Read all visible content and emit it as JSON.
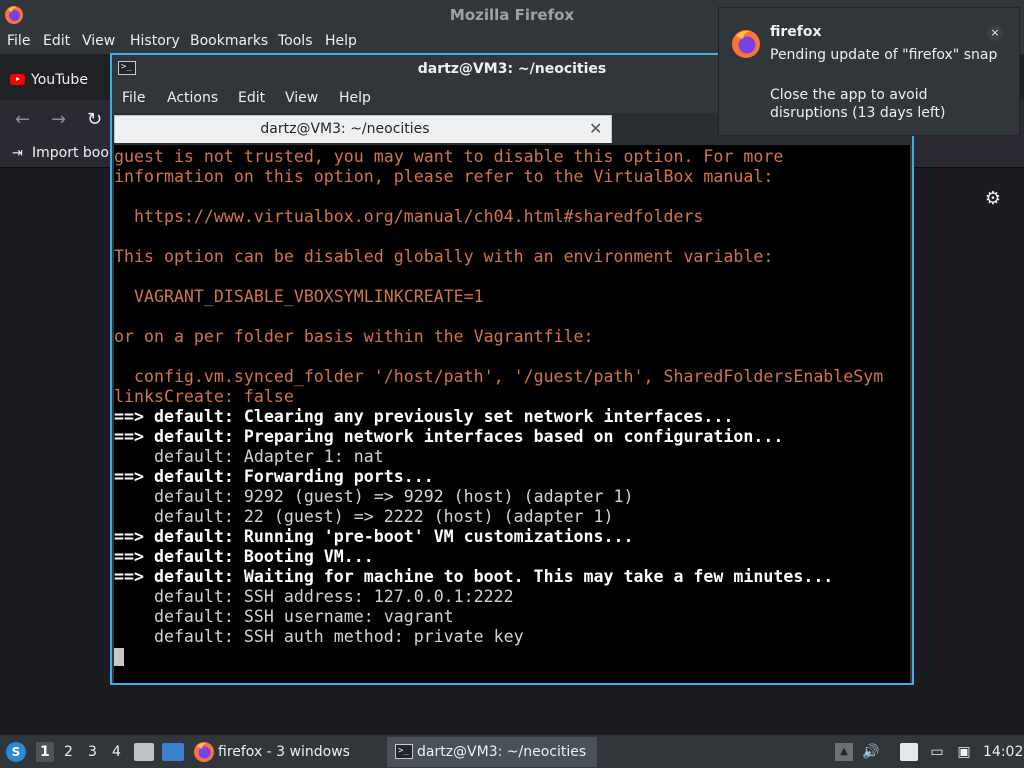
{
  "firefox": {
    "window_title": "Mozilla Firefox",
    "menu": [
      "File",
      "Edit",
      "View",
      "History",
      "Bookmarks",
      "Tools",
      "Help"
    ],
    "tab": {
      "label": "YouTube",
      "icon": "youtube-icon"
    },
    "bookmarks_toolbar": {
      "import_label": "Import book"
    },
    "settings_icon": "gear-icon"
  },
  "terminal": {
    "window_title": "dartz@VM3: ~/neocities",
    "menu": [
      "File",
      "Actions",
      "Edit",
      "View",
      "Help"
    ],
    "tab_label": "dartz@VM3: ~/neocities",
    "tab_close_glyph": "✕",
    "lines": [
      {
        "style": "warn",
        "text": "guest is not trusted, you may want to disable this option. For more"
      },
      {
        "style": "warn",
        "text": "information on this option, please refer to the VirtualBox manual:"
      },
      {
        "style": "warn",
        "text": ""
      },
      {
        "style": "warn",
        "text": "  https://www.virtualbox.org/manual/ch04.html#sharedfolders"
      },
      {
        "style": "warn",
        "text": ""
      },
      {
        "style": "warn",
        "text": "This option can be disabled globally with an environment variable:"
      },
      {
        "style": "warn",
        "text": ""
      },
      {
        "style": "warn",
        "text": "  VAGRANT_DISABLE_VBOXSYMLINKCREATE=1"
      },
      {
        "style": "warn",
        "text": ""
      },
      {
        "style": "warn",
        "text": "or on a per folder basis within the Vagrantfile:"
      },
      {
        "style": "warn",
        "text": ""
      },
      {
        "style": "warn",
        "text": "  config.vm.synced_folder '/host/path', '/guest/path', SharedFoldersEnableSym"
      },
      {
        "style": "warn",
        "text": "linksCreate: false"
      },
      {
        "style": "bold",
        "text": "==> default: Clearing any previously set network interfaces..."
      },
      {
        "style": "bold",
        "text": "==> default: Preparing network interfaces based on configuration..."
      },
      {
        "style": "plain",
        "text": "    default: Adapter 1: nat"
      },
      {
        "style": "bold",
        "text": "==> default: Forwarding ports..."
      },
      {
        "style": "plain",
        "text": "    default: 9292 (guest) => 9292 (host) (adapter 1)"
      },
      {
        "style": "plain",
        "text": "    default: 22 (guest) => 2222 (host) (adapter 1)"
      },
      {
        "style": "bold",
        "text": "==> default: Running 'pre-boot' VM customizations..."
      },
      {
        "style": "bold",
        "text": "==> default: Booting VM..."
      },
      {
        "style": "bold",
        "text": "==> default: Waiting for machine to boot. This may take a few minutes..."
      },
      {
        "style": "plain",
        "text": "    default: SSH address: 127.0.0.1:2222"
      },
      {
        "style": "plain",
        "text": "    default: SSH username: vagrant"
      },
      {
        "style": "plain",
        "text": "    default: SSH auth method: private key"
      }
    ]
  },
  "notification": {
    "app_name": "firefox",
    "summary": "Pending update of \"firefox\" snap",
    "body": "Close the app to avoid disruptions (13 days left)",
    "close_glyph": "×"
  },
  "taskbar": {
    "workspaces": [
      "1",
      "2",
      "3",
      "4"
    ],
    "active_workspace": "1",
    "firefox_task_label": "firefox - 3 windows",
    "terminal_task_label": "dartz@VM3: ~/neocities",
    "clock": "14:02"
  },
  "colors": {
    "accent": "#3daee9",
    "terminal_warning": "#d0744a",
    "panel_bg": "#31363b"
  }
}
